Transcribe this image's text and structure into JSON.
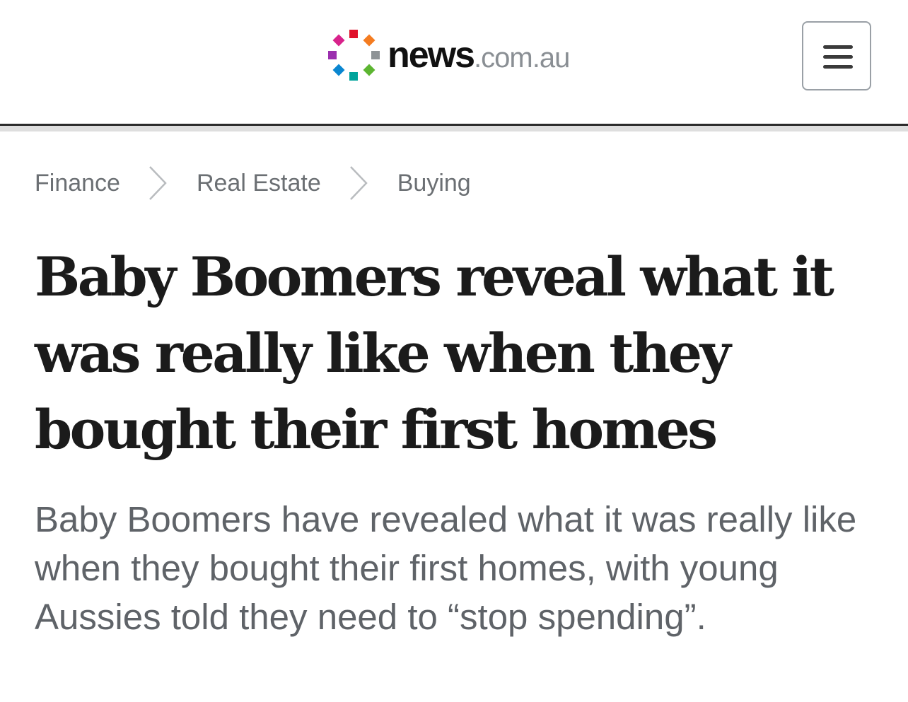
{
  "header": {
    "logo": {
      "brand": "news",
      "suffix": ".com.au",
      "mark_colors": [
        "#e0102a",
        "#f47c20",
        "#8e9396",
        "#5cb531",
        "#00a39b",
        "#0a86d0",
        "#9b2fae",
        "#d8228b"
      ]
    },
    "menu_icon": "hamburger-menu-icon"
  },
  "breadcrumb": {
    "items": [
      {
        "label": "Finance"
      },
      {
        "label": "Real Estate"
      },
      {
        "label": "Buying"
      }
    ],
    "separator_icon": "chevron-right-icon"
  },
  "article": {
    "headline": "Baby Boomers reveal what it was really like when they bought their first homes",
    "standfirst": "Baby Boomers have revealed what it was really like when they bought their first homes, with young Aussies told they need to “stop spending”."
  },
  "colors": {
    "text_dark": "#1b1b1b",
    "text_muted": "#5f6368",
    "breadcrumb": "#6b6f73",
    "rule": "#2b2b2b"
  }
}
